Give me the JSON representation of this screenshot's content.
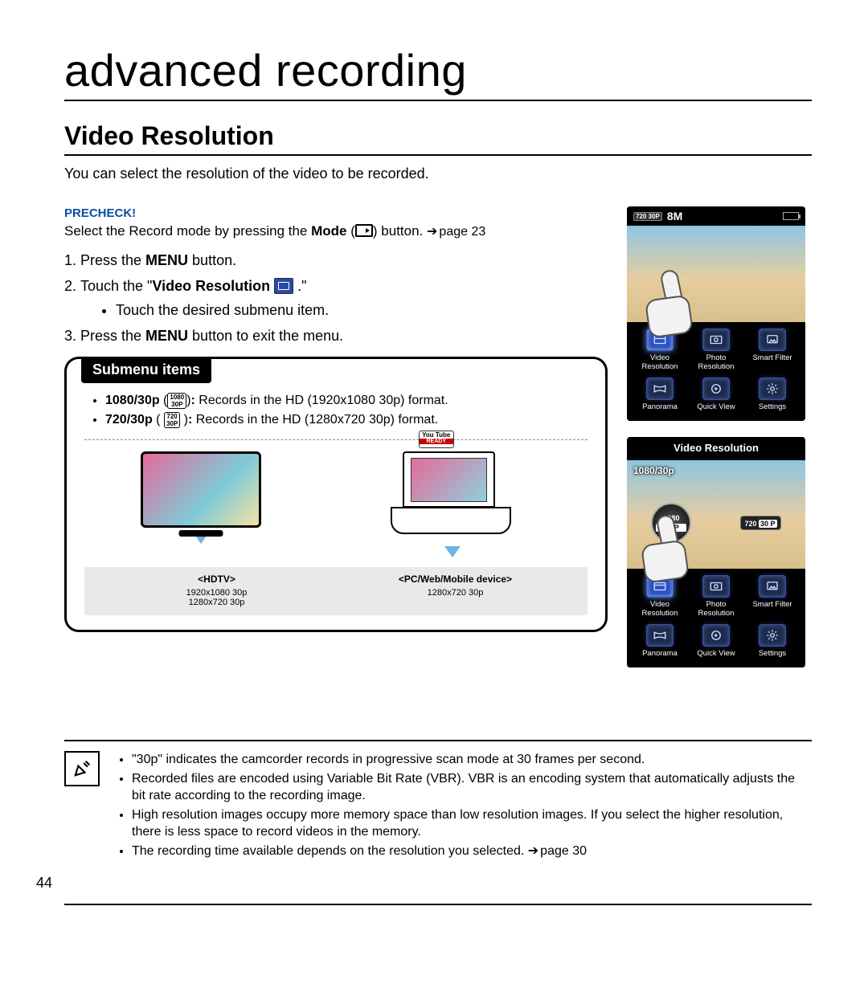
{
  "page_number": "44",
  "chapter_title": "advanced recording",
  "section_title": "Video Resolution",
  "intro": "You can select the resolution of the video to be recorded.",
  "precheck": {
    "label": "PRECHECK!",
    "text_before": "Select the Record mode by pressing the ",
    "mode_label": "Mode",
    "text_after": " button. ",
    "page_ref": "page 23"
  },
  "steps": {
    "s1_a": "Press the ",
    "s1_b": "MENU",
    "s1_c": " button.",
    "s2_a": "Touch the \"",
    "s2_b": "Video Resolution",
    "s2_c": " .\"",
    "s2_sub": "Touch the desired submenu item.",
    "s3_a": "Press the ",
    "s3_b": "MENU",
    "s3_c": " button to exit the menu."
  },
  "submenu": {
    "heading": "Submenu items",
    "items": [
      {
        "name": "1080/30p",
        "badge_top": "1080",
        "badge_bot": "30P",
        "desc": "Records in the HD (1920x1080 30p) format."
      },
      {
        "name": "720/30p",
        "badge_top": "720",
        "badge_bot": "30P",
        "desc": "Records in the HD (1280x720 30p) format."
      }
    ],
    "youtube_badge": "You Tube",
    "youtube_sub": "READY",
    "targets": [
      {
        "title": "<HDTV>",
        "lines": [
          "1920x1080 30p",
          "1280x720 30p"
        ]
      },
      {
        "title": "<PC/Web/Mobile device>",
        "lines": [
          "1280x720 30p"
        ]
      }
    ]
  },
  "cam1": {
    "top_badge": "720 30P",
    "top_res": "8M"
  },
  "cam2": {
    "title": "Video Resolution",
    "overlay_label": "1080/30p",
    "opt_sel_top": "1080",
    "opt_sel_bot": "30 P",
    "opt_alt_top": "720",
    "opt_alt_bot": "30 P"
  },
  "menu": {
    "video_resolution": "Video Resolution",
    "photo_resolution": "Photo Resolution",
    "smart_filter": "Smart Filter",
    "panorama": "Panorama",
    "quick_view": "Quick View",
    "settings": "Settings"
  },
  "notes": [
    "\"30p\" indicates the camcorder records in progressive scan mode at 30 frames per second.",
    "Recorded files are encoded using Variable Bit Rate (VBR). VBR is an encoding system that automatically adjusts the bit rate according to the recording image.",
    "High resolution images occupy more memory space than low resolution images. If you select the higher resolution, there is less space to record videos in the memory.",
    "The recording time available depends on the resolution you selected."
  ],
  "notes_page_ref": "page 30"
}
